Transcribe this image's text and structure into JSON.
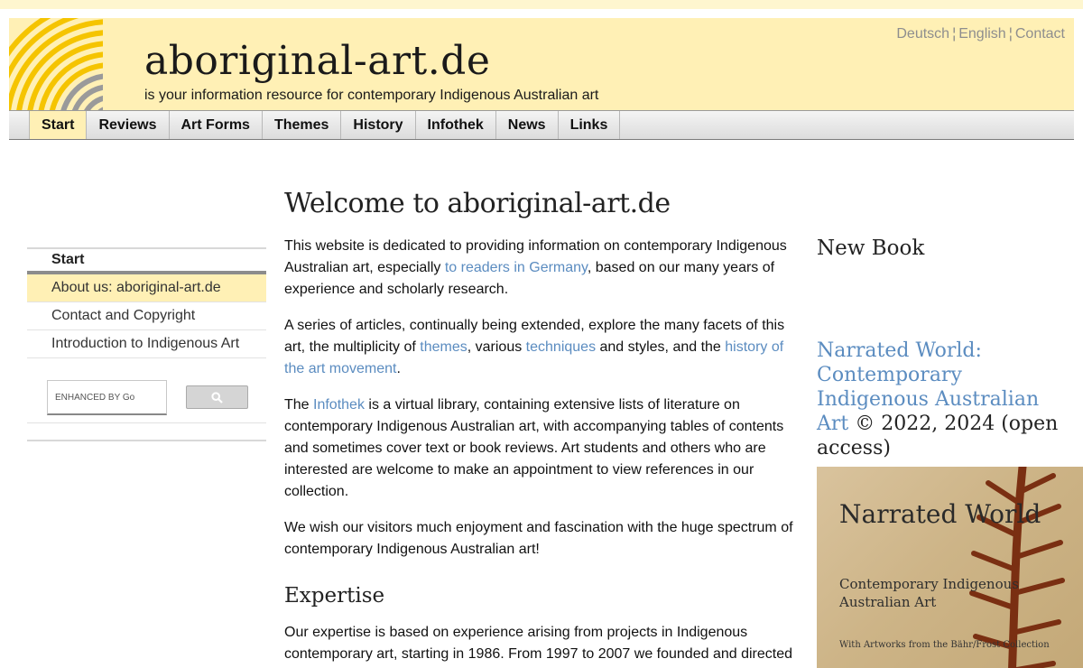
{
  "header": {
    "title": "aboriginal-art.de",
    "tagline": "is your information resource for contemporary Indigenous Australian art",
    "languages": [
      "Deutsch",
      "English",
      "Contact"
    ],
    "language_separator": "¦"
  },
  "nav": {
    "items": [
      "Start",
      "Reviews",
      "Art Forms",
      "Themes",
      "History",
      "Infothek",
      "News",
      "Links"
    ],
    "active": "Start"
  },
  "sidebar": {
    "heading": "Start",
    "items": [
      "About us: aboriginal-art.de",
      "Contact and Copyright",
      "Introduction to Indigenous Art"
    ],
    "active_index": 0,
    "search": {
      "placeholder": "ENHANCED BY Go",
      "button_icon": "search-icon"
    }
  },
  "main": {
    "title": "Welcome to aboriginal-art.de",
    "p1": {
      "before": "This website is dedicated to providing information on contemporary Indigenous Australian art, especially ",
      "link": "to readers in Germany",
      "after": ", based on our many years of experience and scholarly research."
    },
    "p2": {
      "before": "A series of articles, continually being extended, explore the many facets of this art, the multiplicity of ",
      "link1": "themes",
      "mid1": ", various ",
      "link2": "techniques",
      "mid2": " and styles, and the ",
      "link3": "history of the art movement",
      "after": "."
    },
    "p3": {
      "before": "The ",
      "link": "Infothek",
      "after": " is a virtual library, containing extensive lists of literature on contemporary Indigenous Australian art, with accompanying tables of contents and sometimes cover text or book reviews. Art students and others who are interested are welcome to make an appointment to view references in our collection."
    },
    "p4": "We wish our visitors much enjoyment and fascination with the huge spectrum of contemporary Indigenous Australian art!",
    "h2": "Expertise",
    "p5": "Our expertise is based on experience arising from projects in Indigenous contemporary art, starting in 1986. From 1997 to 2007 we founded and directed"
  },
  "right": {
    "heading": "New Book",
    "book_link": "Narrated World: Contemporary Indigenous Australian Art",
    "book_suffix": " © 2022, 2024 (open access)",
    "cover": {
      "title": "Narrated World",
      "subtitle": "Contemporary Indigenous Australian Art",
      "note": "With Artworks from the Bähr/Frost Collection"
    }
  },
  "colors": {
    "header_bg": "#fff0b5",
    "link": "#5b8cc0",
    "logo_yellow": "#f5c400",
    "logo_grey": "#9a9a9a"
  }
}
